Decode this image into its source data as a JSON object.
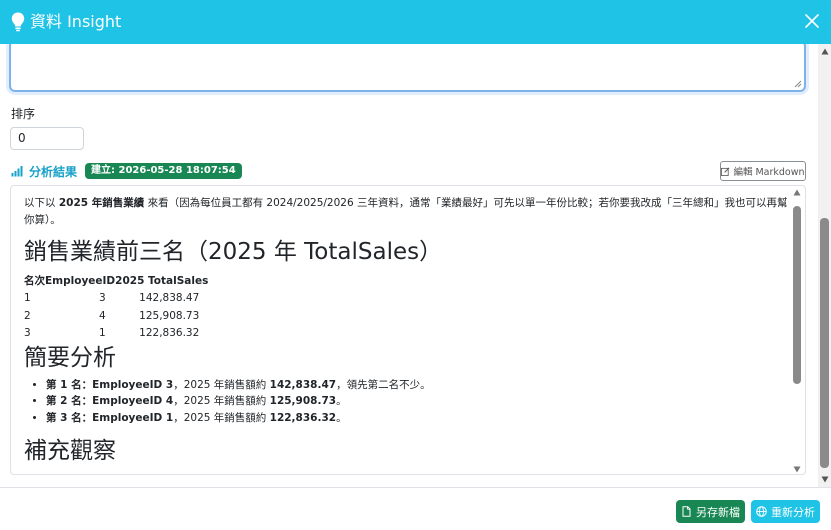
{
  "header": {
    "title": "資料 Insight"
  },
  "sort": {
    "label": "排序",
    "value": "0"
  },
  "result": {
    "label": "分析結果",
    "badge": "建立: 2026-05-28 18:07:54",
    "edit_button": "編輯 Markdown"
  },
  "markdown": {
    "intro_prefix": "以下以 ",
    "intro_bold": "2025 年銷售業績",
    "intro_suffix": " 來看（因為每位員工都有 2024/2025/2026 三年資料，通常「業績最好」可先以單一年份比較；若你要我改成「三年總和」我也可以再幫你算）。",
    "h1": "銷售業績前三名（2025 年 TotalSales）",
    "table": {
      "headers": [
        "名次",
        "EmployeeID",
        "2025 TotalSales"
      ],
      "rows": [
        [
          "1",
          "3",
          "142,838.47"
        ],
        [
          "2",
          "4",
          "125,908.73"
        ],
        [
          "3",
          "1",
          "122,836.32"
        ]
      ]
    },
    "h2_summary": "簡要分析",
    "list": [
      {
        "bold": "第 1 名：EmployeeID 3",
        "text1": "，2025 年銷售額約 ",
        "bold2": "142,838.47",
        "text2": "，領先第二名不少。"
      },
      {
        "bold": "第 2 名：EmployeeID 4",
        "text1": "，2025 年銷售額約 ",
        "bold2": "125,908.73",
        "text2": "。"
      },
      {
        "bold": "第 3 名：EmployeeID 1",
        "text1": "，2025 年銷售額約 ",
        "bold2": "122,836.32",
        "text2": "。"
      }
    ],
    "h2_more": "補充觀察"
  },
  "footer": {
    "save_button": "另存新檔",
    "reanalyze_button": "重新分析"
  },
  "colors": {
    "header_bg": "#1ec3e6",
    "badge_bg": "#198754",
    "save_bg": "#198754",
    "reanalyze_bg": "#1ec3e6"
  }
}
